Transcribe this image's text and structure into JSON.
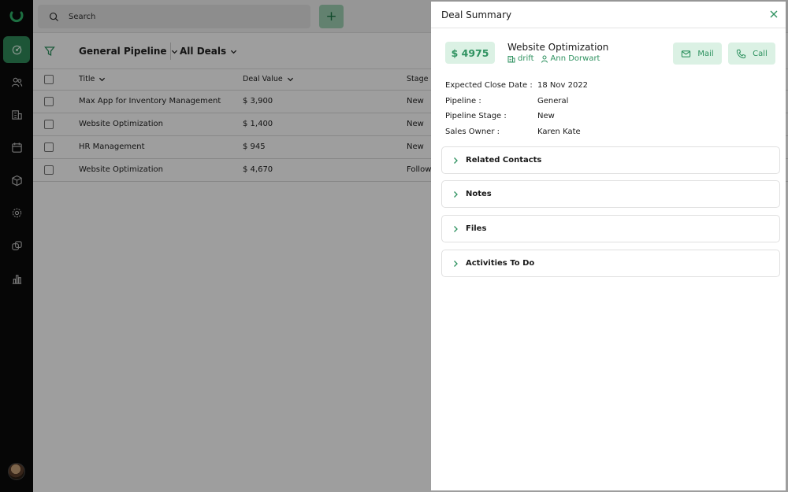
{
  "search": {
    "placeholder": "Search"
  },
  "add_button": {
    "label": "+"
  },
  "filters": {
    "pipeline": "General Pipeline",
    "view": "All Deals"
  },
  "table": {
    "headers": {
      "title": "Title",
      "value": "Deal Value",
      "stage": "Stage"
    },
    "rows": [
      {
        "title": "Max App for Inventory Management",
        "value": "$ 3,900",
        "stage": "New"
      },
      {
        "title": "Website Optimization",
        "value": "$ 1,400",
        "stage": "New"
      },
      {
        "title": "HR Management",
        "value": "$ 945",
        "stage": "New"
      },
      {
        "title": "Website Optimization",
        "value": "$ 4,670",
        "stage": "Follow"
      }
    ]
  },
  "drawer": {
    "title": "Deal Summary",
    "value": "$ 4975",
    "deal_name": "Website Optimization",
    "company": "drift",
    "contact": "Ann Dorwart",
    "mail_label": "Mail",
    "call_label": "Call",
    "info": [
      {
        "key": "Expected Close Date :",
        "value": "18 Nov 2022"
      },
      {
        "key": "Pipeline :",
        "value": "General"
      },
      {
        "key": "Pipeline Stage :",
        "value": "New"
      },
      {
        "key": "Sales Owner :",
        "value": "Karen Kate"
      }
    ],
    "sections": [
      "Related Contacts",
      "Notes",
      "Files",
      "Activities To Do"
    ]
  },
  "colors": {
    "accent": "#2f9260",
    "accent_bg": "#dbf1e4",
    "sidebar": "#0b0b0b"
  },
  "icons": {
    "nav": [
      "dashboard-icon",
      "contacts-icon",
      "companies-icon",
      "calendar-icon",
      "products-icon",
      "settings-icon",
      "integrations-icon",
      "reports-icon"
    ]
  }
}
